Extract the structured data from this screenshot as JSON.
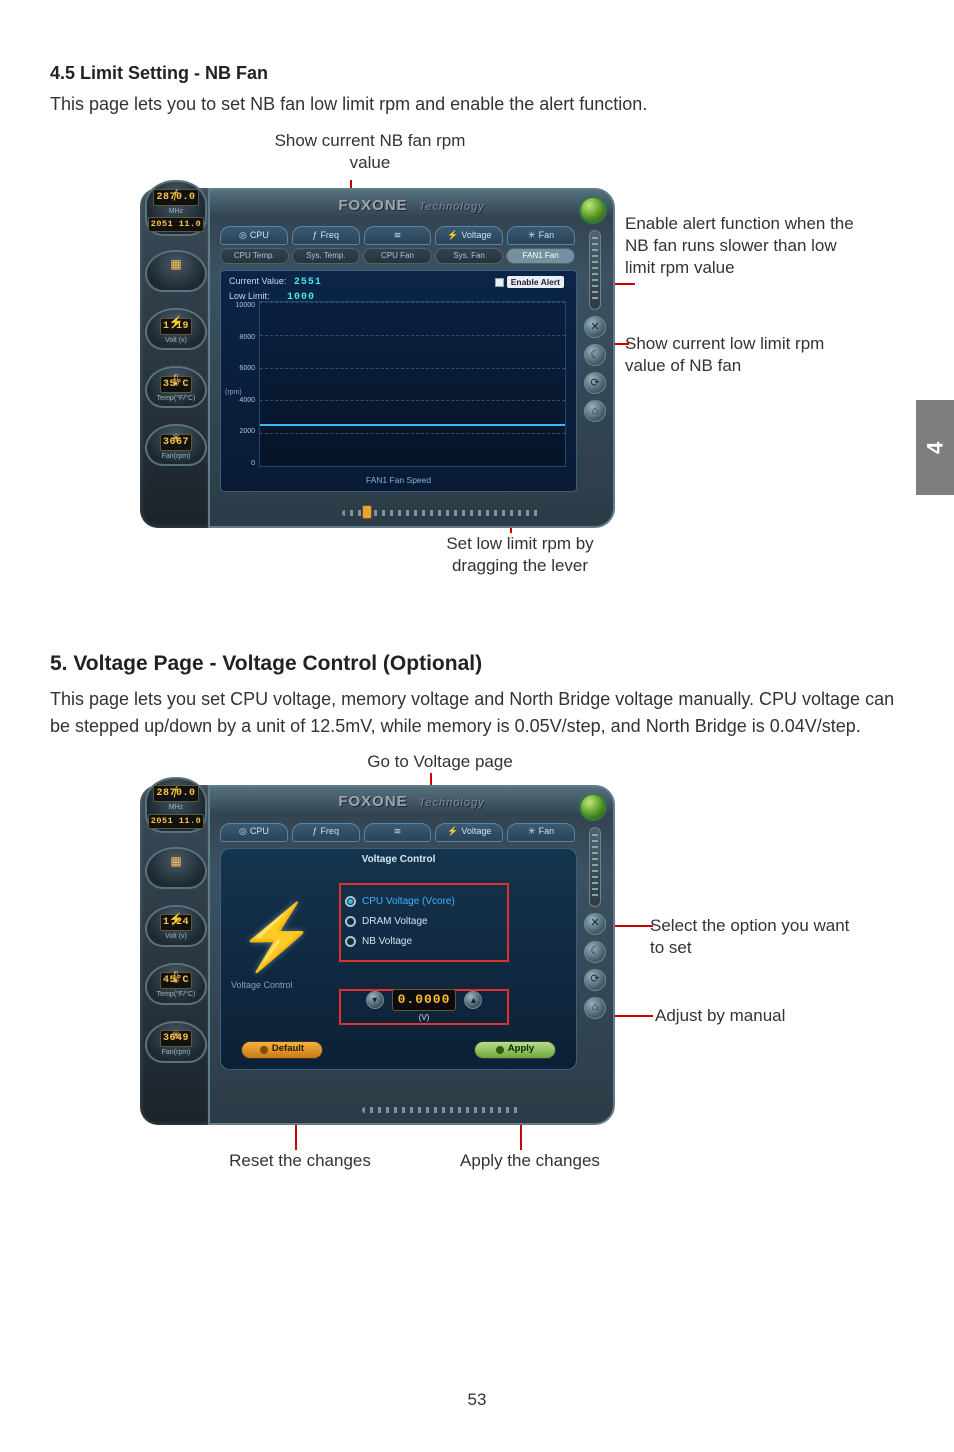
{
  "page_number": "53",
  "side_tab": "4",
  "section45": {
    "heading": "4.5 Limit Setting - NB Fan",
    "body": "This page lets you to set NB fan low limit rpm and enable the alert function.",
    "annot_top": "Show current NB fan rpm value",
    "annot_enable": "Enable alert function when the NB fan runs slower than low limit rpm value",
    "annot_lowlimit": "Show current low limit rpm value of NB fan",
    "annot_slider": "Set low limit rpm by dragging the lever"
  },
  "section5": {
    "heading": "5. Voltage Page - Voltage Control (Optional)",
    "body": "This page lets you set CPU voltage, memory voltage and North Bridge voltage manually. CPU voltage can be stepped up/down by a unit of 12.5mV, while memory is 0.05V/step, and North Bridge is 0.04V/step.",
    "annot_top": "Go to Voltage page",
    "annot_select": "Select the option you want to set",
    "annot_adjust": "Adjust by manual",
    "annot_reset": "Reset the changes",
    "annot_apply": "Apply the changes"
  },
  "app_common": {
    "brand": "FOXONE",
    "brand_suffix": "Technology",
    "tabs": [
      "CPU",
      "Freq",
      "",
      "Voltage",
      "Fan"
    ],
    "subtabs_fan": [
      "CPU Temp.",
      "Sys. Temp.",
      "CPU Fan",
      "Sys. Fan",
      "FAN1 Fan"
    ],
    "rail_icons": [
      "✕",
      "☾",
      "⟳",
      "⌂"
    ]
  },
  "gauges1": {
    "freq_top": "2870.0",
    "freq_unit": "MHz",
    "freq_sub": "2051 11.0",
    "volt": "1.19",
    "volt_unit": "Volt (v)",
    "temp": "35°C",
    "temp_unit": "Temp(°F/°C)",
    "fan": "3667",
    "fan_unit": "Fan(rpm)"
  },
  "gauges2": {
    "freq_top": "2870.0",
    "freq_unit": "MHz",
    "freq_sub": "2051 11.0",
    "volt": "1.24",
    "volt_unit": "Volt (v)",
    "temp": "45°C",
    "temp_unit": "Temp(°F/°C)",
    "fan": "3649",
    "fan_unit": "Fan(rpm)"
  },
  "fan_panel": {
    "current_label": "Current Value:",
    "current_value": "2551",
    "low_label": "Low Limit:",
    "low_value": "1000",
    "enable_alert": "Enable Alert",
    "footer": "FAN1 Fan Speed",
    "y_ticks": [
      "10000",
      "8000",
      "6000",
      "4000",
      "2000",
      "0"
    ],
    "y_unit": "(rpm)"
  },
  "volt_panel": {
    "title": "Voltage Control",
    "sidebar_label": "Voltage Control",
    "options": [
      "CPU Voltage (Vcore)",
      "DRAM Voltage",
      "NB Voltage"
    ],
    "value": "0.0000",
    "value_unit": "(V)",
    "default_btn": "Default",
    "apply_btn": "Apply"
  },
  "chart_data": {
    "type": "line",
    "title": "FAN1 Fan Speed",
    "xlabel": "",
    "ylabel": "(rpm)",
    "ylim": [
      0,
      10000
    ],
    "y_ticks": [
      0,
      2000,
      4000,
      6000,
      8000,
      10000
    ],
    "series": [
      {
        "name": "FAN1 rpm",
        "values": [
          2551
        ]
      }
    ],
    "low_limit_marker": 1000
  }
}
